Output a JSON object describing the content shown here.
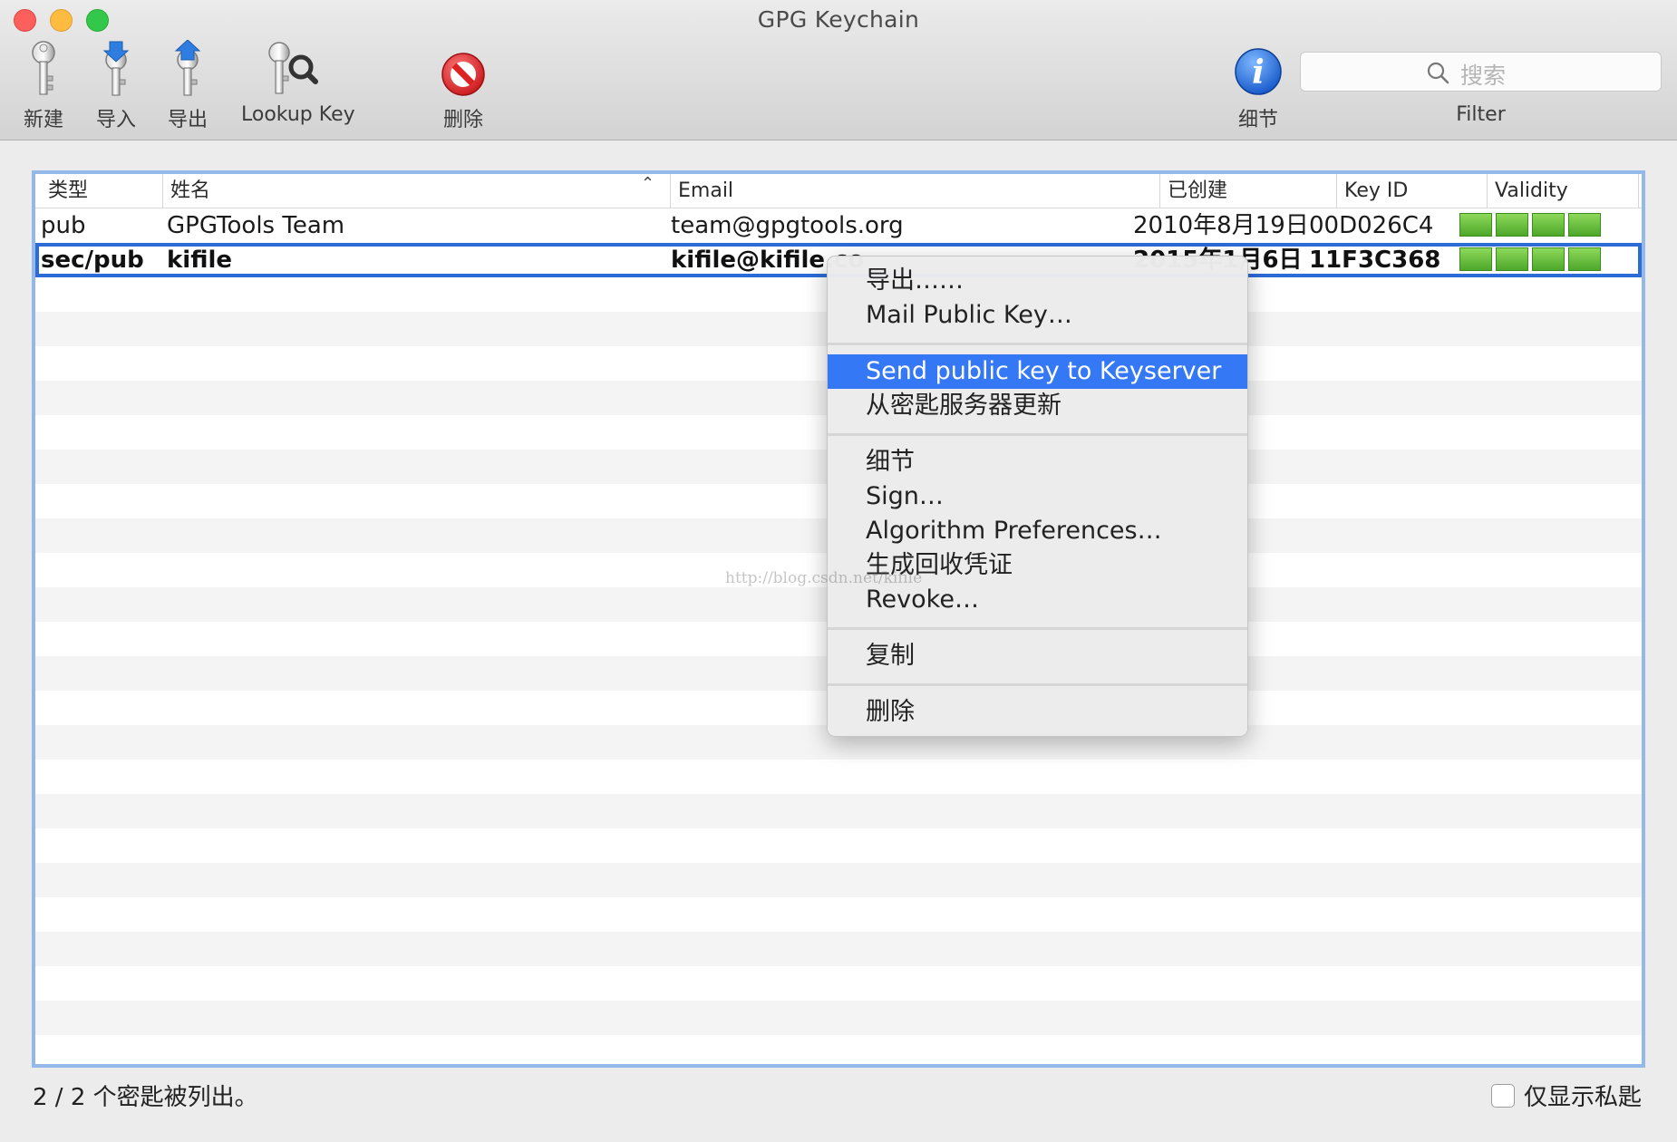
{
  "window": {
    "title": "GPG Keychain"
  },
  "toolbar": {
    "new_label": "新建",
    "import_label": "导入",
    "export_label": "导出",
    "lookup_label": "Lookup Key",
    "delete_label": "删除",
    "details_label": "细节",
    "search_placeholder": "搜索",
    "filter_label": "Filter"
  },
  "table": {
    "headers": {
      "type": "类型",
      "name": "姓名",
      "email": "Email",
      "created": "已创建",
      "key_id": "Key ID",
      "validity": "Validity"
    },
    "rows": [
      {
        "type": "pub",
        "name": "GPGTools Team",
        "email": "team@gpgtools.org",
        "created": "2010年8月19日",
        "key_id": "00D026C4",
        "validity_segments": 4
      },
      {
        "type": "sec/pub",
        "name": "kifile",
        "email": "kifile@kifile.co",
        "created": "2015年1月6日",
        "key_id": "11F3C368",
        "validity_segments": 4,
        "selected": true
      }
    ]
  },
  "context_menu": {
    "export": "导出……",
    "mail_public_key": "Mail Public Key…",
    "send_to_keyserver": "Send public key to Keyserver",
    "update_from_keyserver": "从密匙服务器更新",
    "details": "细节",
    "sign": "Sign…",
    "algorithm_preferences": "Algorithm Preferences…",
    "generate_revocation": "生成回收凭证",
    "revoke": "Revoke…",
    "copy": "复制",
    "delete": "删除"
  },
  "watermark": "http://blog.csdn.net/kifile",
  "footer": {
    "status": "2 / 2 个密匙被列出。",
    "secret_only_label": "仅显示私匙",
    "secret_only_checked": false
  },
  "colors": {
    "selection_border": "#2d6bd6",
    "menu_highlight": "#3478f6",
    "validity_green": "#5fbf35",
    "table_focus_ring": "#93b9ea"
  }
}
